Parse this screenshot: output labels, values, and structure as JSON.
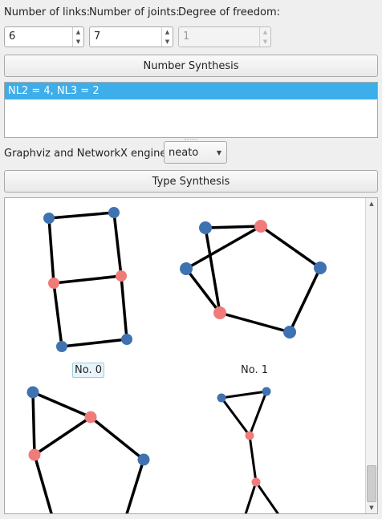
{
  "labels": {
    "links": "Number of links:",
    "joints": "Number of joints:",
    "dof": "Degree of freedom:"
  },
  "inputs": {
    "links": "6",
    "joints": "7",
    "dof": "1"
  },
  "buttons": {
    "number_synthesis": "Number Synthesis",
    "type_synthesis": "Type Synthesis"
  },
  "results": {
    "items": [
      "NL2 = 4, NL3 = 2"
    ]
  },
  "engine": {
    "label": "Graphviz and NetworkX engine:",
    "value": "neato"
  },
  "graphs": {
    "captions": [
      "No. 0",
      "No. 1"
    ],
    "colors": {
      "node_blue": "#3f72b0",
      "node_red": "#f07b7b",
      "edge": "#000000",
      "selection": "#3daee9"
    }
  },
  "icons": {
    "spin_up": "▲",
    "spin_down": "▼",
    "combo_arrow": "▼",
    "scroll_up": "▲",
    "scroll_down": "▼"
  }
}
